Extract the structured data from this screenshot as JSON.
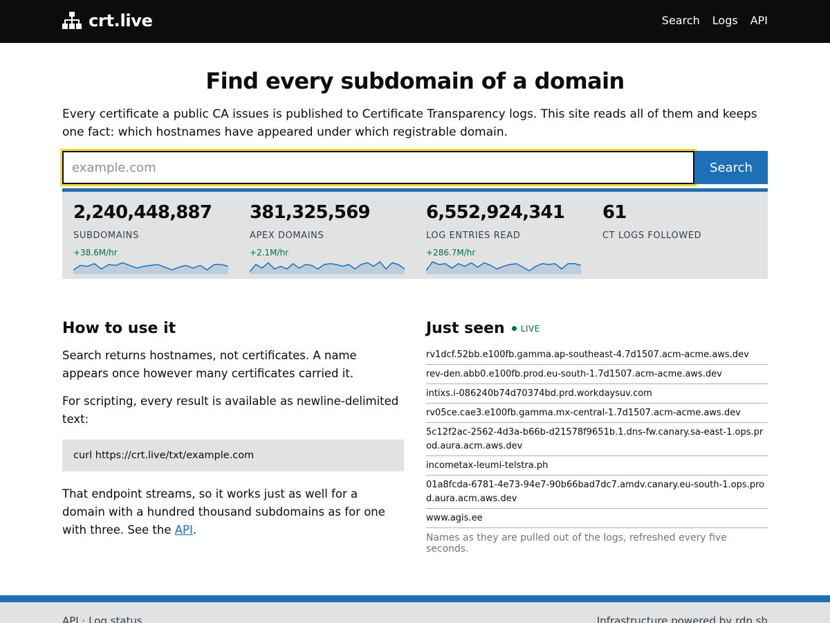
{
  "header": {
    "brand": "crt.live",
    "brand_icon": "sitemap-icon",
    "nav": [
      "Search",
      "Logs",
      "API"
    ]
  },
  "hero": {
    "title": "Find every subdomain of a domain",
    "intro": "Every certificate a public CA issues is published to Certificate Transparency logs. This site reads all of them and keeps one fact: which hostnames have appeared under which registrable domain."
  },
  "search": {
    "placeholder": "example.com",
    "value": "",
    "button": "Search"
  },
  "stats": [
    {
      "value": "2,240,448,887",
      "label": "SUBDOMAINS",
      "rate": "+38.6M/hr",
      "spark": [
        4,
        9,
        8,
        11,
        5,
        10,
        9,
        12,
        9,
        6,
        8,
        9,
        10,
        7,
        4,
        7,
        9,
        6,
        9,
        4,
        10,
        10,
        8
      ]
    },
    {
      "value": "381,325,569",
      "label": "APEX DOMAINS",
      "rate": "+2.1M/hr",
      "spark": [
        2,
        10,
        6,
        12,
        5,
        8,
        5,
        11,
        6,
        10,
        9,
        5,
        10,
        11,
        10,
        8,
        10,
        5,
        10,
        12,
        8,
        13,
        5,
        12,
        10,
        5
      ]
    },
    {
      "value": "6,552,924,341",
      "label": "LOG ENTRIES READ",
      "rate": "+286.7M/hr",
      "spark": [
        3,
        13,
        10,
        11,
        6,
        11,
        8,
        12,
        7,
        12,
        9,
        5,
        8,
        10,
        11,
        7,
        3,
        8,
        11,
        10,
        11,
        5,
        11,
        11,
        9
      ]
    },
    {
      "value": "61",
      "label": "CT LOGS FOLLOWED",
      "rate": "",
      "spark": []
    }
  ],
  "how": {
    "title": "How to use it",
    "p1": "Search returns hostnames, not certificates. A name appears once however many certificates carried it.",
    "p2": "For scripting, every result is available as newline-delimited text:",
    "code": "curl https://crt.live/txt/example.com",
    "p3_before": "That endpoint streams, so it works just as well for a domain with a hundred thousand subdomains as for one with three. See the ",
    "p3_link": "API",
    "p3_after": "."
  },
  "seen": {
    "title": "Just seen",
    "live": "LIVE",
    "items": [
      "rv1dcf.52bb.e100fb.gamma.ap-southeast-4.7d1507.acm-acme.aws.dev",
      "rev-den.abb0.e100fb.prod.eu-south-1.7d1507.acm-acme.aws.dev",
      "intixs.i-086240b74d70374bd.prd.workdaysuv.com",
      "rv05ce.cae3.e100fb.gamma.mx-central-1.7d1507.acm-acme.aws.dev",
      "5c12f2ac-2562-4d3a-b66b-d21578f9651b.1.dns-fw.canary.sa-east-1.ops.prod.aura.acm.aws.dev",
      "incometax-leumi-telstra.ph",
      "01a8fcda-6781-4e73-94e7-90b66bad7dc7.amdv.canary.eu-south-1.ops.prod.aura.acm.aws.dev",
      "www.agis.ee"
    ],
    "note": "Names as they are pulled out of the logs, refreshed every five seconds."
  },
  "footer": {
    "left_links": [
      "API",
      "Log status"
    ],
    "separator": "·",
    "right_text": "Infrastructure powered by ",
    "right_link": "rdp.sh"
  },
  "colors": {
    "header_bg": "#0b0c0c",
    "accent": "#1d70b8",
    "focus": "#ffdd00",
    "stats_bg": "#e0e2e4",
    "rate_green": "#00703c"
  }
}
